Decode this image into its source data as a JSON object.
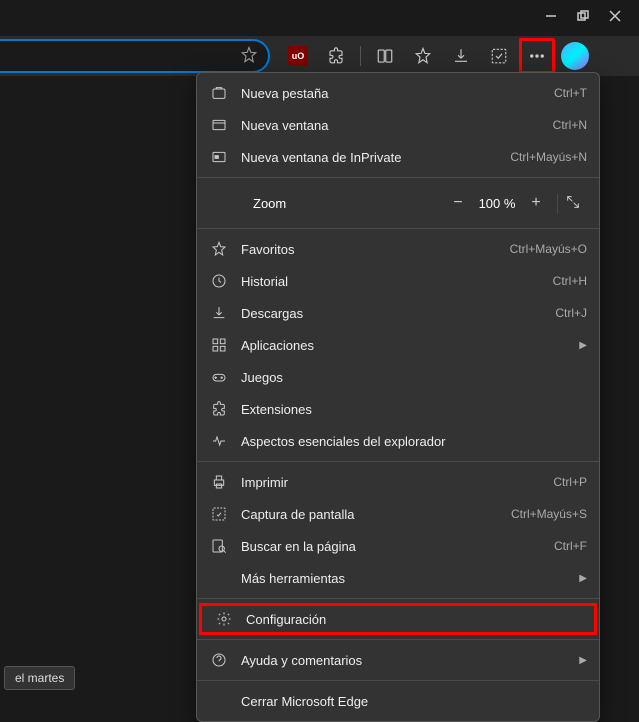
{
  "window_controls": {
    "minimize": "−",
    "maximize": "❐",
    "close": "✕"
  },
  "toolbar": {
    "ublock_label": "uO",
    "more_highlighted": true
  },
  "menu": {
    "items": [
      {
        "icon": "tab",
        "label": "Nueva pestaña",
        "shortcut": "Ctrl+T"
      },
      {
        "icon": "window",
        "label": "Nueva ventana",
        "shortcut": "Ctrl+N"
      },
      {
        "icon": "inprivate",
        "label": "Nueva ventana de InPrivate",
        "shortcut": "Ctrl+Mayús+N"
      }
    ],
    "zoom": {
      "label": "Zoom",
      "minus": "−",
      "value": "100 %",
      "plus": "+",
      "fullscreen": "⤢"
    },
    "items2": [
      {
        "icon": "star",
        "label": "Favoritos",
        "shortcut": "Ctrl+Mayús+O"
      },
      {
        "icon": "history",
        "label": "Historial",
        "shortcut": "Ctrl+H"
      },
      {
        "icon": "download",
        "label": "Descargas",
        "shortcut": "Ctrl+J"
      },
      {
        "icon": "apps",
        "label": "Aplicaciones",
        "submenu": true
      },
      {
        "icon": "games",
        "label": "Juegos"
      },
      {
        "icon": "puzzle",
        "label": "Extensiones"
      },
      {
        "icon": "heart",
        "label": "Aspectos esenciales del explorador"
      }
    ],
    "items3": [
      {
        "icon": "print",
        "label": "Imprimir",
        "shortcut": "Ctrl+P"
      },
      {
        "icon": "capture",
        "label": "Captura de pantalla",
        "shortcut": "Ctrl+Mayús+S"
      },
      {
        "icon": "find",
        "label": "Buscar en la página",
        "shortcut": "Ctrl+F"
      },
      {
        "icon": "",
        "label": "Más herramientas",
        "submenu": true
      }
    ],
    "settings": {
      "icon": "gear",
      "label": "Configuración"
    },
    "items4": [
      {
        "icon": "help",
        "label": "Ayuda y comentarios",
        "submenu": true
      }
    ],
    "close_edge": {
      "label": "Cerrar Microsoft Edge"
    }
  },
  "bottom_tab": "el martes"
}
